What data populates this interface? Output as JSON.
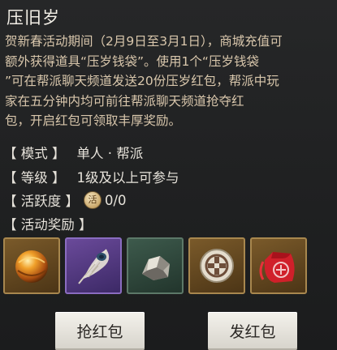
{
  "title": "压旧岁",
  "description_lines": [
    "贺新春活动期间（2月9日至3月1日），商城充值可",
    "额外获得道具“压岁钱袋”。使用1个“压岁钱袋",
    "”可在帮派聊天频道发送20份压岁红包，帮派中玩",
    "家在五分钟内均可前往帮派聊天频道抢夺红",
    "包，开启红包可领取丰厚奖励。"
  ],
  "mode": {
    "label": "【 模式 】",
    "value": "单人 · 帮派"
  },
  "level": {
    "label": "【 等级 】",
    "value": "1级及以上可参与"
  },
  "activity": {
    "label": "【 活跃度 】",
    "icon_char": "活",
    "value": "0/0"
  },
  "rewards": {
    "label": "【 活动奖励 】",
    "items": [
      {
        "icon": "golden-orb-icon",
        "rarity_color": "#a8874e"
      },
      {
        "icon": "peacock-feather-icon",
        "rarity_color": "#8a6cc0"
      },
      {
        "icon": "stone-ore-icon",
        "rarity_color": "#5c7868"
      },
      {
        "icon": "silver-coin-icon",
        "rarity_color": "#a8874e"
      },
      {
        "icon": "red-pouch-icon",
        "rarity_color": "#a8874e"
      }
    ]
  },
  "buttons": {
    "grab": "抢红包",
    "send": "发红包"
  }
}
